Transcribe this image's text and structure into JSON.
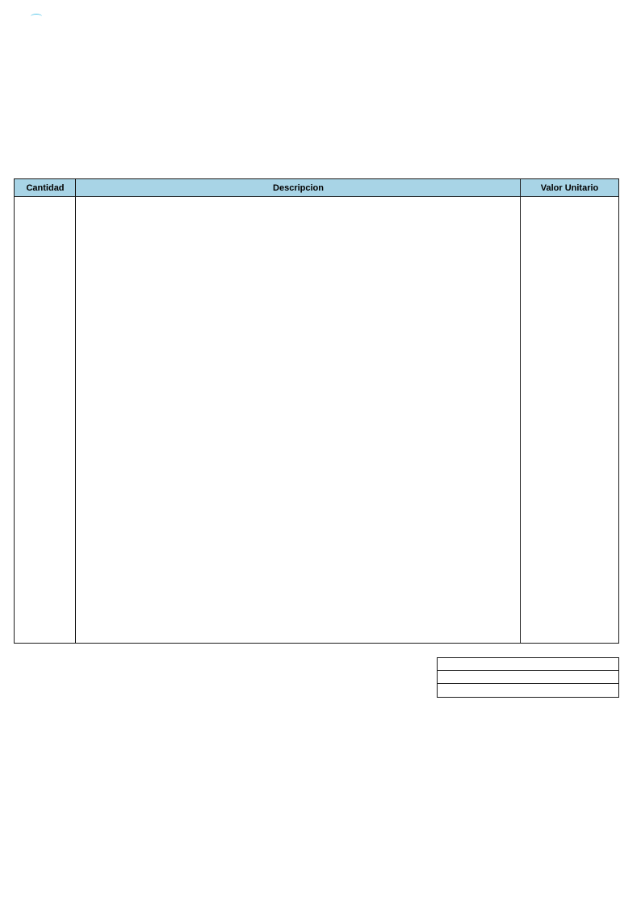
{
  "table": {
    "columns": [
      {
        "label": "Cantidad"
      },
      {
        "label": "Descripcion"
      },
      {
        "label": "Valor Unitario"
      }
    ],
    "rows": []
  },
  "totals": {
    "rows": [
      "",
      "",
      ""
    ]
  }
}
